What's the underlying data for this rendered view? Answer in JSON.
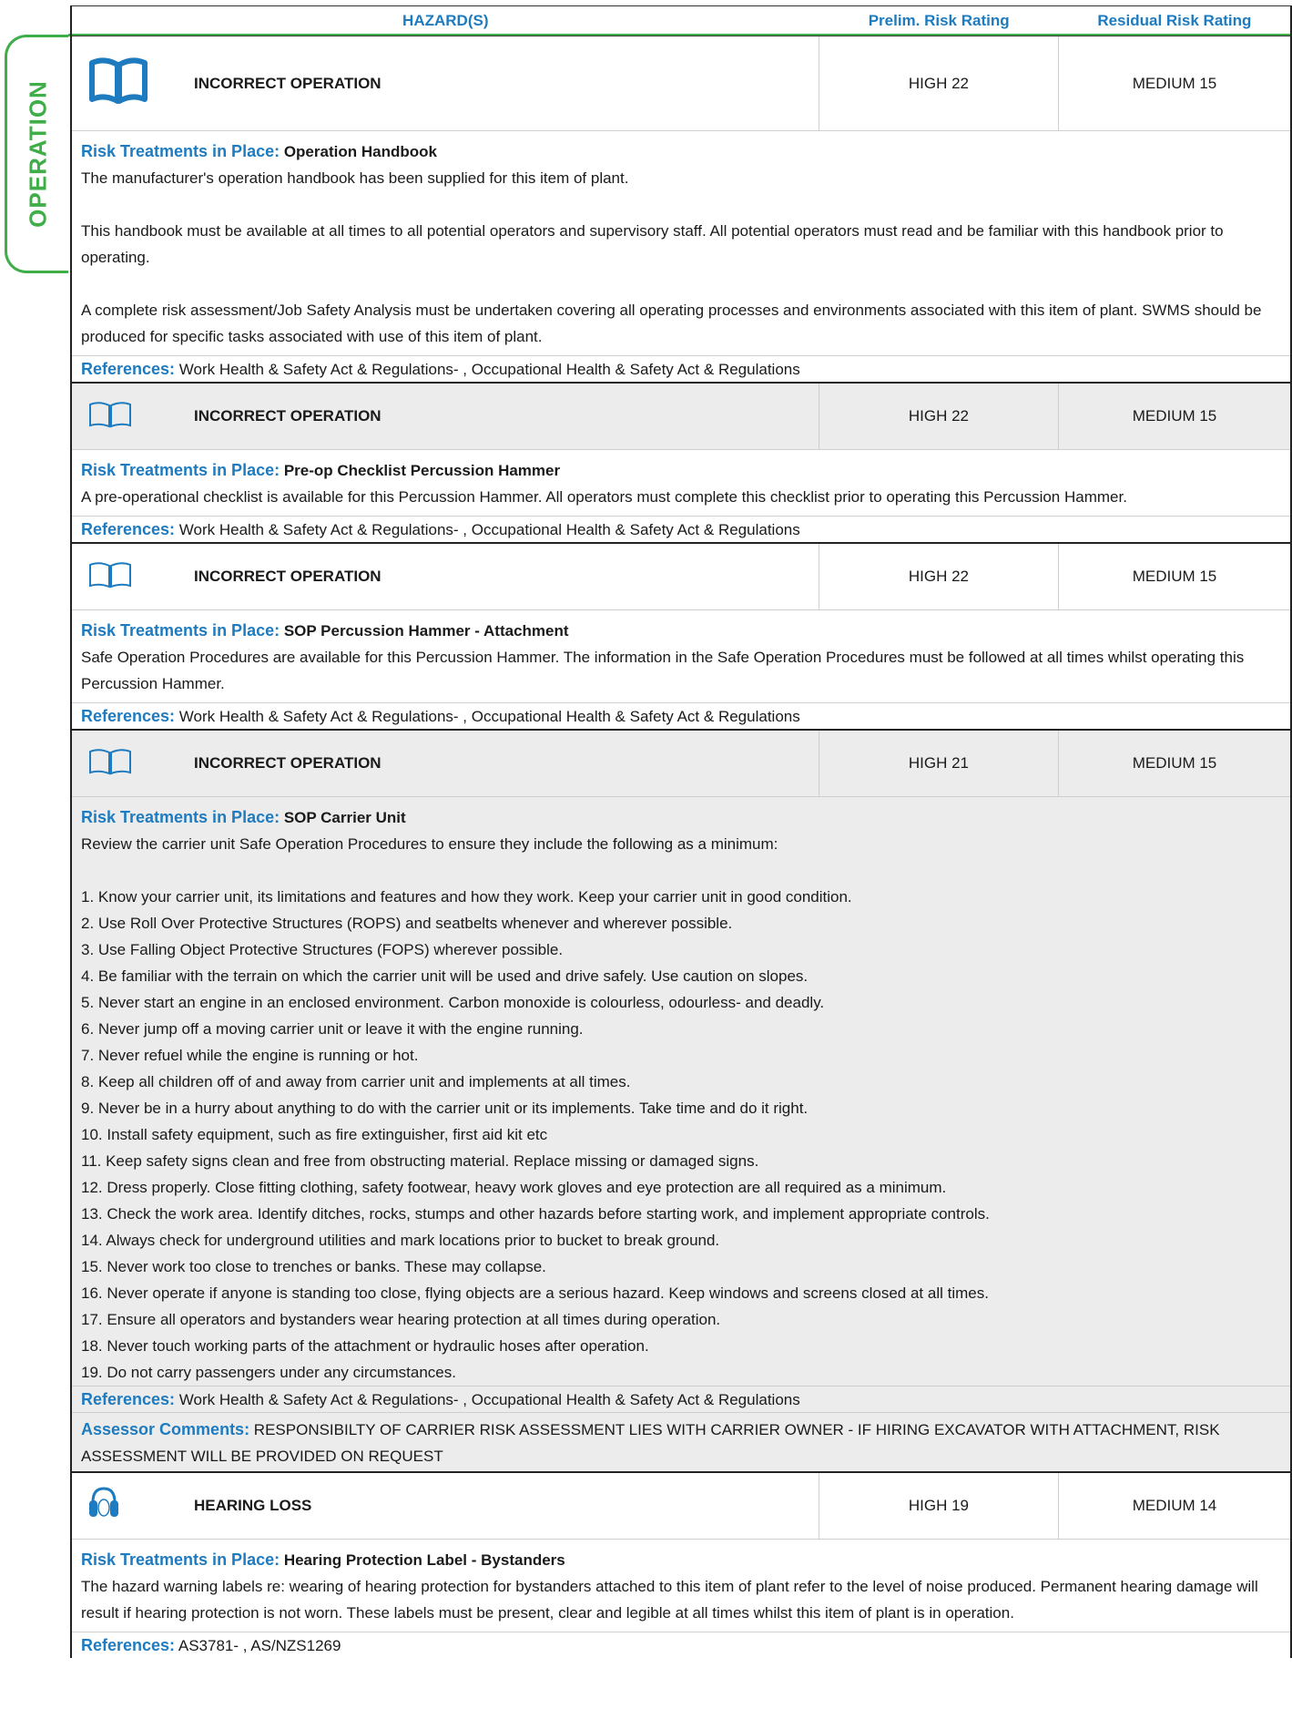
{
  "header": {
    "hazards": "HAZARD(S)",
    "prelim": "Prelim. Risk Rating",
    "residual": "Residual Risk Rating"
  },
  "section_tab": "OPERATION",
  "labels": {
    "risk_treatments": "Risk Treatments in Place:",
    "references": "References:",
    "assessor_comments": "Assessor Comments:"
  },
  "hazards": [
    {
      "icon": "book-icon",
      "title": "INCORRECT OPERATION",
      "prelim": "HIGH 22",
      "residual": "MEDIUM 15",
      "treatment": "Operation Handbook",
      "paragraphs": [
        "The manufacturer's operation handbook has been supplied for this item of plant.",
        "",
        "This handbook must be available at all times to all potential operators and supervisory staff. All potential operators must read and be familiar with this handbook prior to operating.",
        "",
        "A complete risk assessment/Job Safety Analysis must be undertaken covering all operating processes and environments associated with this item of plant. SWMS should be produced for specific tasks associated with use of this item of plant."
      ],
      "references": "Work Health & Safety Act & Regulations- , Occupational Health & Safety Act & Regulations"
    },
    {
      "icon": "book-icon",
      "title": "INCORRECT OPERATION",
      "prelim": "HIGH 22",
      "residual": "MEDIUM 15",
      "treatment": "Pre-op Checklist Percussion Hammer",
      "paragraphs": [
        "A pre-operational checklist is available for this Percussion Hammer. All operators must complete this checklist prior to operating this Percussion Hammer."
      ],
      "references": "Work Health & Safety Act & Regulations- , Occupational Health & Safety Act & Regulations"
    },
    {
      "icon": "book-icon",
      "title": "INCORRECT OPERATION",
      "prelim": "HIGH 22",
      "residual": "MEDIUM 15",
      "treatment": "SOP Percussion Hammer - Attachment",
      "paragraphs": [
        "Safe Operation Procedures are available for this Percussion Hammer. The information in the Safe Operation Procedures must be followed at all times whilst operating this Percussion Hammer."
      ],
      "references": "Work Health & Safety Act & Regulations- , Occupational Health & Safety Act & Regulations"
    },
    {
      "icon": "book-icon",
      "title": "INCORRECT OPERATION",
      "prelim": "HIGH 21",
      "residual": "MEDIUM 15",
      "treatment": "SOP Carrier Unit",
      "intro": "Review the carrier unit Safe Operation Procedures to ensure they include the following as a minimum:",
      "items": [
        "1. Know your carrier unit, its limitations and features and how they work. Keep your carrier unit in good condition.",
        "2. Use Roll Over Protective Structures (ROPS) and seatbelts whenever and wherever possible.",
        "3. Use Falling Object Protective Structures (FOPS) wherever possible.",
        "4. Be familiar with the terrain on which the carrier unit will be used and drive safely. Use caution on slopes.",
        "5. Never start an engine in an enclosed environment. Carbon monoxide is colourless, odourless- and deadly.",
        "6. Never jump off a moving carrier unit or leave it with the engine running.",
        "7. Never refuel while the engine is running or hot.",
        "8. Keep all children off of and away from carrier unit and implements at all times.",
        "9. Never be in a hurry about anything to do with the carrier unit or its implements. Take time and do it right.",
        "10. Install safety equipment, such as fire extinguisher, first aid kit etc",
        "11. Keep safety signs clean and free from obstructing material. Replace missing or damaged signs.",
        "12. Dress properly. Close fitting clothing, safety footwear, heavy work gloves and eye protection are all required as a minimum.",
        "13. Check the work area. Identify ditches, rocks, stumps and other hazards before starting work, and implement appropriate controls.",
        "14. Always check for underground utilities and mark locations prior to bucket to break ground.",
        "15. Never work too close to trenches or banks. These may collapse.",
        "16. Never operate if anyone is standing too close, flying objects are a serious hazard. Keep windows and screens closed at all times.",
        "17. Ensure all operators and bystanders wear hearing protection at all times during operation.",
        "18. Never touch working parts of the attachment or hydraulic hoses after operation.",
        "19. Do not carry passengers under any circumstances."
      ],
      "references": "Work Health & Safety Act & Regulations- , Occupational Health & Safety Act & Regulations",
      "assessor": "RESPONSIBILTY OF CARRIER RISK ASSESSMENT LIES WITH CARRIER OWNER - IF HIRING EXCAVATOR WITH ATTACHMENT, RISK ASSESSMENT WILL BE PROVIDED ON REQUEST"
    },
    {
      "icon": "ear-protection-icon",
      "title": "HEARING LOSS",
      "prelim": "HIGH 19",
      "residual": "MEDIUM 14",
      "treatment": "Hearing Protection Label - Bystanders",
      "paragraphs": [
        "The hazard warning labels re: wearing of hearing protection for bystanders attached to this item of plant refer to the level of noise produced. Permanent hearing damage will result if hearing protection is not worn. These labels must be present, clear and legible at all times whilst this item of plant is in operation."
      ],
      "references": "AS3781- , AS/NZS1269"
    }
  ]
}
